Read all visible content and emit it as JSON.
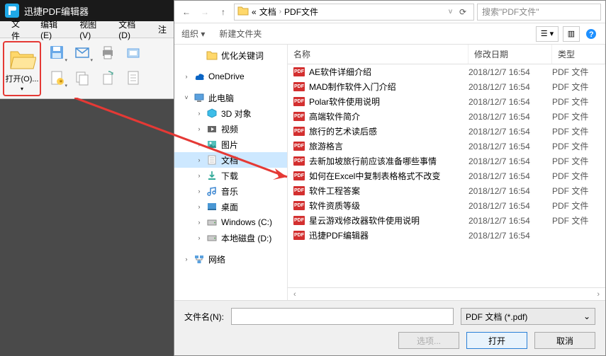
{
  "app": {
    "title": "迅捷PDF编辑器",
    "menu": [
      "文件",
      "编辑(E)",
      "视图(V)",
      "文档(D)",
      "注"
    ],
    "open": "打开(O)..."
  },
  "dialog": {
    "breadcrumb": [
      "文档",
      "PDF文件"
    ],
    "search_placeholder": "搜索\"PDF文件\"",
    "toolbar": {
      "organize": "组织 ▾",
      "newfolder": "新建文件夹"
    },
    "tree": [
      {
        "label": "优化关键词",
        "level": 2,
        "icon": "folder",
        "twist": ""
      },
      {
        "label": "",
        "level": 0,
        "icon": "",
        "twist": ""
      },
      {
        "label": "OneDrive",
        "level": 0,
        "icon": "onedrive",
        "twist": "›"
      },
      {
        "label": "",
        "level": 0,
        "icon": "",
        "twist": ""
      },
      {
        "label": "此电脑",
        "level": 0,
        "icon": "pc",
        "twist": "˅"
      },
      {
        "label": "3D 对象",
        "level": 2,
        "icon": "3d",
        "twist": "›"
      },
      {
        "label": "视频",
        "level": 2,
        "icon": "video",
        "twist": "›"
      },
      {
        "label": "图片",
        "level": 2,
        "icon": "pic",
        "twist": "›"
      },
      {
        "label": "文档",
        "level": 2,
        "icon": "doc",
        "twist": "›",
        "sel": true
      },
      {
        "label": "下载",
        "level": 2,
        "icon": "dl",
        "twist": "›"
      },
      {
        "label": "音乐",
        "level": 2,
        "icon": "music",
        "twist": "›"
      },
      {
        "label": "桌面",
        "level": 2,
        "icon": "desk",
        "twist": "›"
      },
      {
        "label": "Windows (C:)",
        "level": 2,
        "icon": "disk",
        "twist": "›"
      },
      {
        "label": "本地磁盘 (D:)",
        "level": 2,
        "icon": "disk",
        "twist": "›"
      },
      {
        "label": "",
        "level": 0,
        "icon": "",
        "twist": ""
      },
      {
        "label": "网络",
        "level": 0,
        "icon": "net",
        "twist": "›"
      }
    ],
    "columns": {
      "name": "名称",
      "date": "修改日期",
      "type": "类型"
    },
    "files": [
      {
        "name": "AE软件详细介绍",
        "date": "2018/12/7 16:54",
        "type": "PDF 文件"
      },
      {
        "name": "MAD制作软件入门介绍",
        "date": "2018/12/7 16:54",
        "type": "PDF 文件"
      },
      {
        "name": "Polar软件使用说明",
        "date": "2018/12/7 16:54",
        "type": "PDF 文件"
      },
      {
        "name": "高端软件简介",
        "date": "2018/12/7 16:54",
        "type": "PDF 文件"
      },
      {
        "name": "旅行的艺术读后感",
        "date": "2018/12/7 16:54",
        "type": "PDF 文件"
      },
      {
        "name": "旅游格言",
        "date": "2018/12/7 16:54",
        "type": "PDF 文件"
      },
      {
        "name": "去新加坡旅行前应该准备哪些事情",
        "date": "2018/12/7 16:54",
        "type": "PDF 文件"
      },
      {
        "name": "如何在Excel中复制表格格式不改变",
        "date": "2018/12/7 16:54",
        "type": "PDF 文件"
      },
      {
        "name": "软件工程答案",
        "date": "2018/12/7 16:54",
        "type": "PDF 文件"
      },
      {
        "name": "软件资质等级",
        "date": "2018/12/7 16:54",
        "type": "PDF 文件"
      },
      {
        "name": "星云游戏修改器软件使用说明",
        "date": "2018/12/7 16:54",
        "type": "PDF 文件"
      },
      {
        "name": "迅捷PDF编辑器",
        "date": "2018/12/7 16:54",
        "type": ""
      }
    ],
    "footer": {
      "filenameLabel": "文件名(N):",
      "filter": "PDF 文档 (*.pdf)",
      "options": "选项...",
      "open": "打开",
      "cancel": "取消"
    }
  }
}
